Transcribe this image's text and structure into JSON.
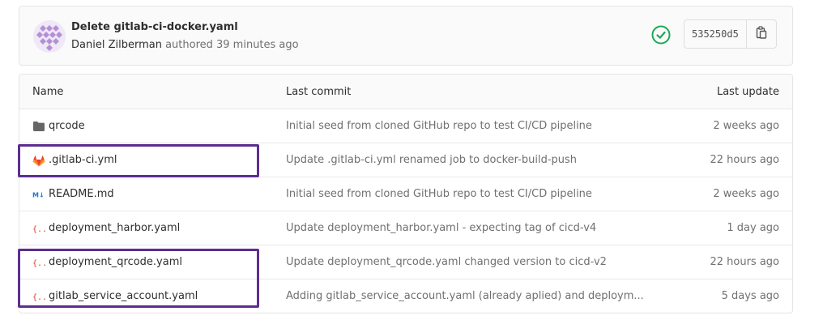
{
  "commit": {
    "title": "Delete gitlab-ci-docker.yaml",
    "author": "Daniel Zilberman",
    "meta_suffix": " authored 39 minutes ago",
    "sha": "535250d5",
    "status": "passed"
  },
  "table": {
    "headers": {
      "name": "Name",
      "last_commit": "Last commit",
      "last_update": "Last update"
    },
    "rows": [
      {
        "icon": "folder-icon",
        "name": "qrcode",
        "commit": "Initial seed from cloned GitHub repo to test CI/CD pipeline",
        "date": "2 weeks ago"
      },
      {
        "icon": "gitlab-logo-icon",
        "name": ".gitlab-ci.yml",
        "commit": "Update .gitlab-ci.yml renamed job to docker-build-push",
        "date": "22 hours ago"
      },
      {
        "icon": "markdown-icon",
        "name": "README.md",
        "commit": "Initial seed from cloned GitHub repo to test CI/CD pipeline",
        "date": "2 weeks ago"
      },
      {
        "icon": "yaml-file-icon",
        "name": "deployment_harbor.yaml",
        "commit": "Update deployment_harbor.yaml - expecting tag of cicd-v4",
        "date": "1 day ago"
      },
      {
        "icon": "yaml-file-icon",
        "name": "deployment_qrcode.yaml",
        "commit": "Update deployment_qrcode.yaml changed version to cicd-v2",
        "date": "22 hours ago"
      },
      {
        "icon": "yaml-file-icon",
        "name": "gitlab_service_account.yaml",
        "commit": "Adding gitlab_service_account.yaml (already aplied) and deploym...",
        "date": "5 days ago"
      }
    ]
  },
  "colors": {
    "highlight": "#5c2e91",
    "status_success": "#1aaa55",
    "yaml_icon": "#db3b21",
    "markdown_icon": "#1f78d1",
    "gitlab_orange": "#fc6d26"
  }
}
